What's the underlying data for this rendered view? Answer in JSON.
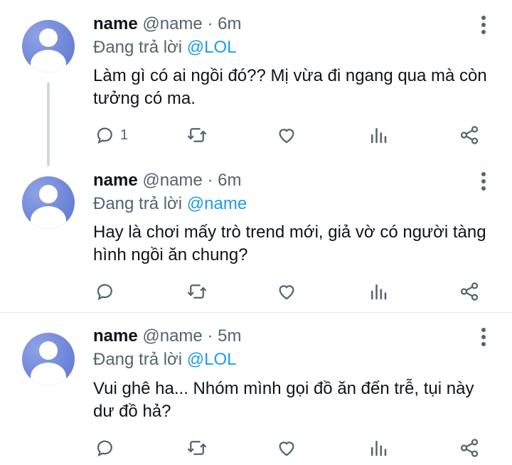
{
  "tweets": [
    {
      "name": "name",
      "handle": "@name",
      "separator": "·",
      "time": "6m",
      "replying_prefix": "Đang trả lời",
      "replying_to": "@LOL",
      "text": "Làm gì có ai ngồi đó?? Mị vừa đi ngang qua mà còn tưởng có ma.",
      "reply_count": "1"
    },
    {
      "name": "name",
      "handle": "@name",
      "separator": "·",
      "time": "6m",
      "replying_prefix": "Đang trả lời",
      "replying_to": "@name",
      "text": "Hay là chơi mấy trò trend mới, giả vờ có người tàng hình ngồi ăn chung?",
      "reply_count": ""
    },
    {
      "name": "name",
      "handle": "@name",
      "separator": "·",
      "time": "5m",
      "replying_prefix": "Đang trả lời",
      "replying_to": "@LOL",
      "text": "Vui ghê ha... Nhóm mình gọi đồ ăn đến trễ, tụi này dư đồ hả?",
      "reply_count": ""
    }
  ],
  "icons": {
    "reply": "reply-icon",
    "retweet": "retweet-icon",
    "like": "heart-icon",
    "views": "views-icon",
    "share": "share-icon",
    "more": "more-vertical-icon"
  },
  "colors": {
    "text": "#0f1419",
    "muted": "#536471",
    "mention": "#1d9bf0",
    "avatar": "#6f86d8",
    "thread_line": "#cfd9de"
  }
}
